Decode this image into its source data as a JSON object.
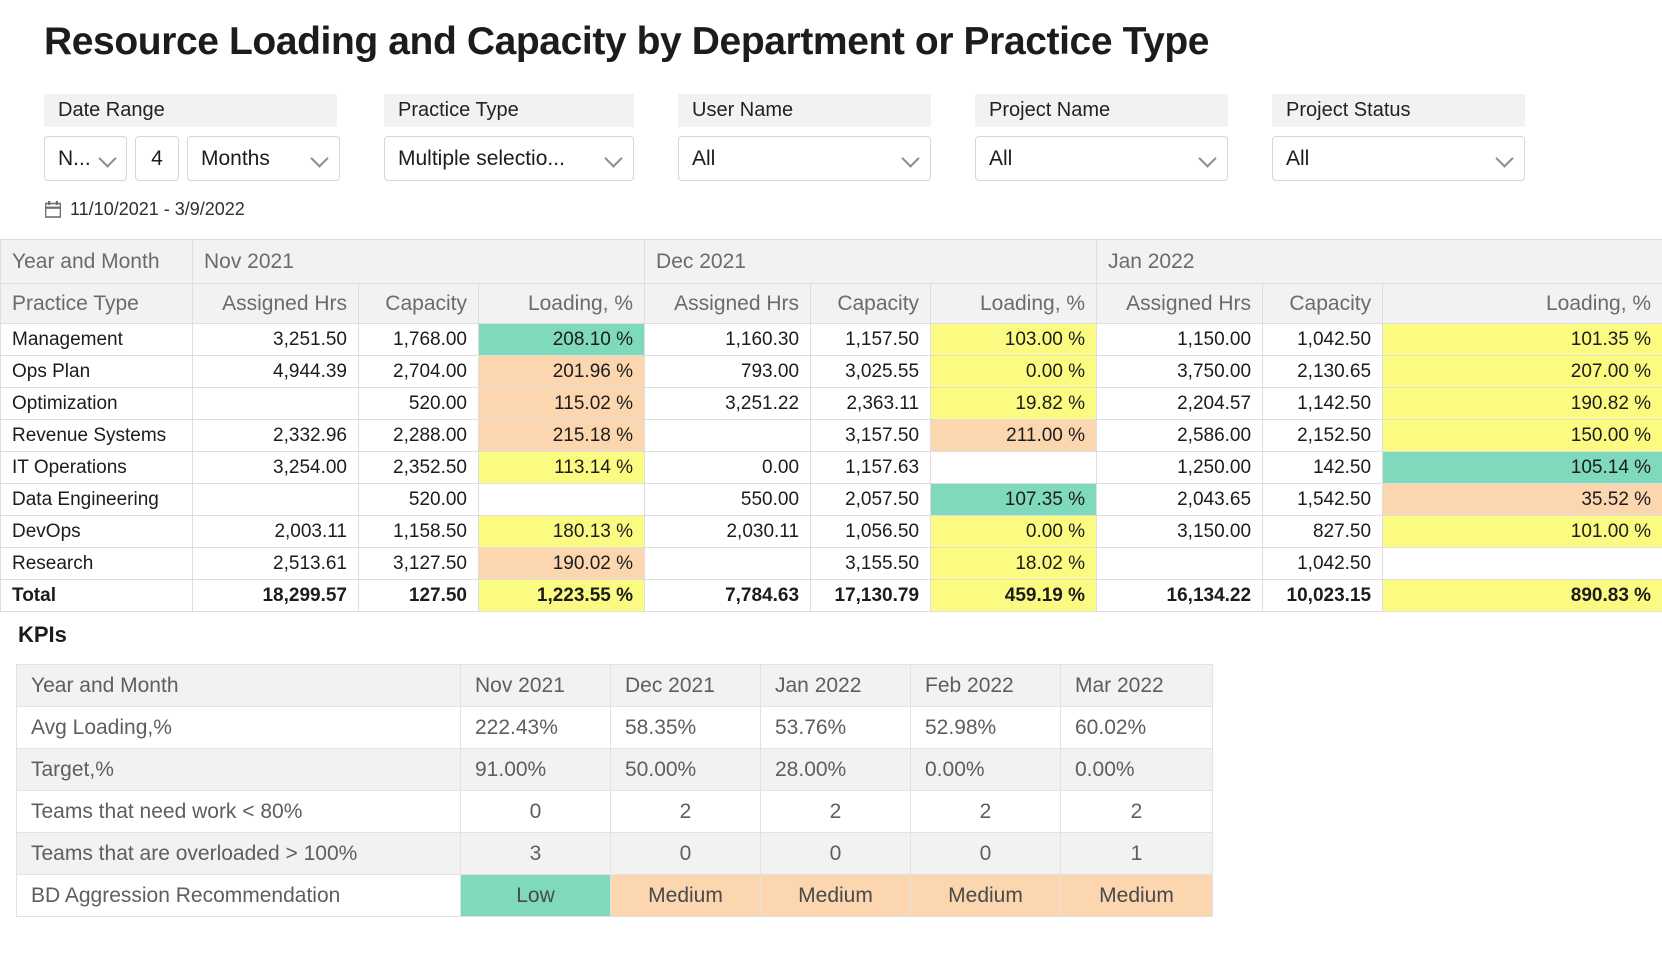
{
  "header": {
    "title": "Resource Loading and Capacity by Department or Practice Type"
  },
  "filters": {
    "date_range": {
      "label": "Date Range",
      "start_value": "N...",
      "count_value": "4",
      "unit_value": "Months"
    },
    "practice_type": {
      "label": "Practice Type",
      "value": "Multiple selectio..."
    },
    "user_name": {
      "label": "User Name",
      "value": "All"
    },
    "project_name": {
      "label": "Project Name",
      "value": "All"
    },
    "project_status": {
      "label": "Project Status",
      "value": "All"
    }
  },
  "date_caption": {
    "icon": "calendar-icon",
    "text": "11/10/2021 - 3/9/2022"
  },
  "matrix": {
    "corner_label": "Year and Month",
    "row_header_label": "Practice Type",
    "months": [
      "Nov 2021",
      "Dec 2021",
      "Jan 2022"
    ],
    "sub_headers": [
      "Assigned Hrs",
      "Capacity",
      "Loading, %"
    ],
    "rows": [
      {
        "name": "Management",
        "cells": [
          {
            "assigned": "3,251.50",
            "capacity": "1,768.00",
            "loading": "208.10 %",
            "hl": "green"
          },
          {
            "assigned": "1,160.30",
            "capacity": "1,157.50",
            "loading": "103.00 %",
            "hl": "yellow"
          },
          {
            "assigned": "1,150.00",
            "capacity": "1,042.50",
            "loading": "101.35 %",
            "hl": "yellow"
          }
        ]
      },
      {
        "name": "Ops Plan",
        "cells": [
          {
            "assigned": "4,944.39",
            "capacity": "2,704.00",
            "loading": "201.96 %",
            "hl": "orange"
          },
          {
            "assigned": "793.00",
            "capacity": "3,025.55",
            "loading": "0.00 %",
            "hl": "yellow"
          },
          {
            "assigned": "3,750.00",
            "capacity": "2,130.65",
            "loading": "207.00 %",
            "hl": "yellow"
          }
        ]
      },
      {
        "name": "Optimization",
        "cells": [
          {
            "assigned": "",
            "capacity": "520.00",
            "loading": "115.02 %",
            "hl": "orange"
          },
          {
            "assigned": "3,251.22",
            "capacity": "2,363.11",
            "loading": "19.82 %",
            "hl": "yellow"
          },
          {
            "assigned": "2,204.57",
            "capacity": "1,142.50",
            "loading": "190.82 %",
            "hl": "yellow"
          }
        ]
      },
      {
        "name": "Revenue Systems",
        "cells": [
          {
            "assigned": "2,332.96",
            "capacity": "2,288.00",
            "loading": "215.18 %",
            "hl": "orange"
          },
          {
            "assigned": "",
            "capacity": "3,157.50",
            "loading": "211.00 %",
            "hl": "orange"
          },
          {
            "assigned": "2,586.00",
            "capacity": "2,152.50",
            "loading": "150.00 %",
            "hl": "yellow"
          }
        ]
      },
      {
        "name": "IT Operations",
        "cells": [
          {
            "assigned": "3,254.00",
            "capacity": "2,352.50",
            "loading": "113.14 %",
            "hl": "yellow"
          },
          {
            "assigned": "0.00",
            "capacity": "1,157.63",
            "loading": "",
            "hl": "none"
          },
          {
            "assigned": "1,250.00",
            "capacity": "142.50",
            "loading": "105.14 %",
            "hl": "green"
          }
        ]
      },
      {
        "name": "Data Engineering",
        "cells": [
          {
            "assigned": "",
            "capacity": "520.00",
            "loading": "",
            "hl": "none"
          },
          {
            "assigned": "550.00",
            "capacity": "2,057.50",
            "loading": "107.35 %",
            "hl": "green"
          },
          {
            "assigned": "2,043.65",
            "capacity": "1,542.50",
            "loading": "35.52 %",
            "hl": "orange"
          }
        ]
      },
      {
        "name": "DevOps",
        "cells": [
          {
            "assigned": "2,003.11",
            "capacity": "1,158.50",
            "loading": "180.13 %",
            "hl": "yellow"
          },
          {
            "assigned": "2,030.11",
            "capacity": "1,056.50",
            "loading": "0.00 %",
            "hl": "yellow"
          },
          {
            "assigned": "3,150.00",
            "capacity": "827.50",
            "loading": "101.00 %",
            "hl": "yellow"
          }
        ]
      },
      {
        "name": "Research",
        "cells": [
          {
            "assigned": "2,513.61",
            "capacity": "3,127.50",
            "loading": "190.02 %",
            "hl": "orange"
          },
          {
            "assigned": "",
            "capacity": "3,155.50",
            "loading": "18.02 %",
            "hl": "yellow"
          },
          {
            "assigned": "",
            "capacity": "1,042.50",
            "loading": "",
            "hl": "none"
          }
        ]
      }
    ],
    "total_row": {
      "name": "Total",
      "cells": [
        {
          "assigned": "18,299.57",
          "capacity": "127.50",
          "loading": "1,223.55 %",
          "hl": "yellow"
        },
        {
          "assigned": "7,784.63",
          "capacity": "17,130.79",
          "loading": "459.19 %",
          "hl": "yellow"
        },
        {
          "assigned": "16,134.22",
          "capacity": "10,023.15",
          "loading": "890.83 %",
          "hl": "yellow"
        }
      ]
    }
  },
  "kpis": {
    "section_title": "KPIs",
    "header_label": "Year and Month",
    "months": [
      "Nov 2021",
      "Dec 2021",
      "Jan 2022",
      "Feb 2022",
      "Mar 2022"
    ],
    "rows": [
      {
        "name": "Avg Loading,%",
        "values": [
          "222.43%",
          "58.35%",
          "53.76%",
          "52.98%",
          "60.02%"
        ],
        "align": "left",
        "highlights": [
          "none",
          "none",
          "none",
          "none",
          "none"
        ]
      },
      {
        "name": "Target,%",
        "values": [
          "91.00%",
          "50.00%",
          "28.00%",
          "0.00%",
          "0.00%"
        ],
        "align": "left",
        "highlights": [
          "none",
          "none",
          "none",
          "none",
          "none"
        ]
      },
      {
        "name": "Teams that need work < 80%",
        "values": [
          "0",
          "2",
          "2",
          "2",
          "2"
        ],
        "align": "center",
        "highlights": [
          "none",
          "none",
          "none",
          "none",
          "none"
        ]
      },
      {
        "name": "Teams that are overloaded > 100%",
        "values": [
          "3",
          "0",
          "0",
          "0",
          "1"
        ],
        "align": "center",
        "highlights": [
          "none",
          "none",
          "none",
          "none",
          "none"
        ]
      },
      {
        "name": "BD Aggression Recommendation",
        "values": [
          "Low",
          "Medium",
          "Medium",
          "Medium",
          "Medium"
        ],
        "align": "center",
        "highlights": [
          "green",
          "orange",
          "orange",
          "orange",
          "orange"
        ]
      }
    ]
  },
  "colors": {
    "highlight_green": "#7FD9BD",
    "highlight_orange": "#FBD6AE",
    "highlight_yellow": "#FBFB81",
    "header_bg": "#F2F2F2",
    "header_text": "#6B6B6B",
    "border": "#DEDEDE"
  }
}
